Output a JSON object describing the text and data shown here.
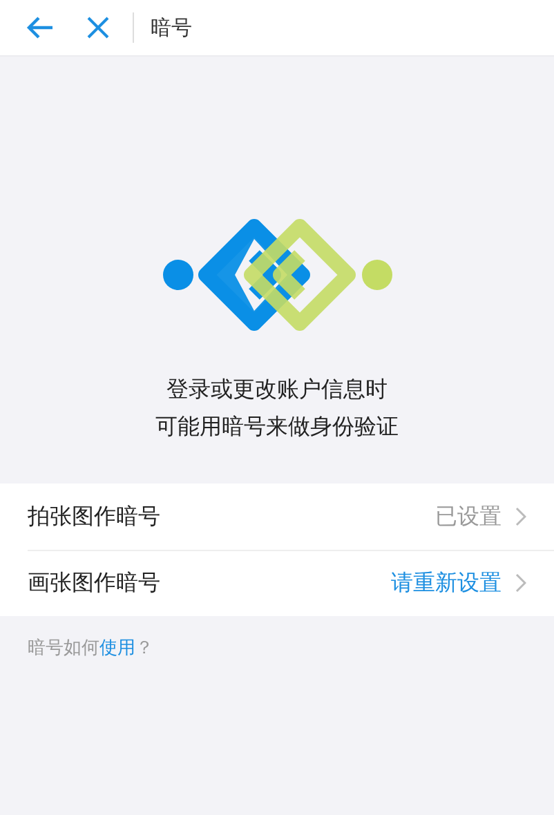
{
  "header": {
    "title": "暗号"
  },
  "intro": {
    "lines": [
      "登录或更改账户信息时",
      "可能用暗号来做身份验证"
    ]
  },
  "options": [
    {
      "label": "拍张图作暗号",
      "status": "已设置",
      "kind": "done"
    },
    {
      "label": "画张图作暗号",
      "status": "请重新设置",
      "kind": "action"
    }
  ],
  "help": {
    "prefix": "暗号如何",
    "link": "使用",
    "suffix": "？"
  }
}
